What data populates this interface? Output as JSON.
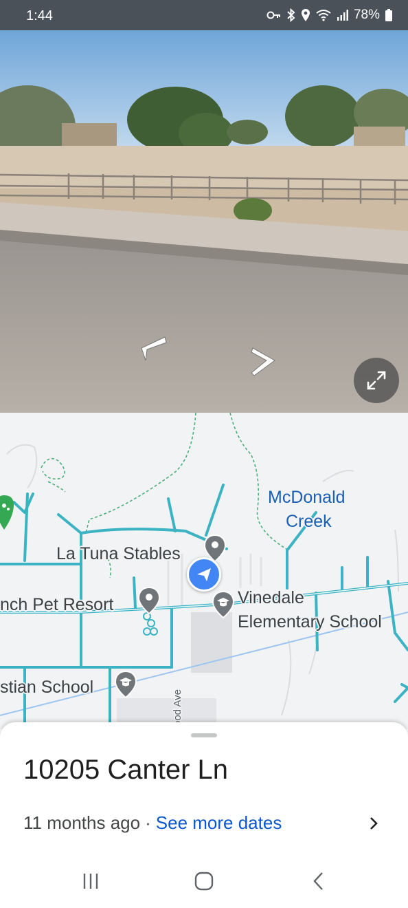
{
  "status_bar": {
    "time": "1:44",
    "battery": "78%",
    "icons": [
      "key-icon",
      "bluetooth-icon",
      "location-icon",
      "wifi-icon",
      "signal-icon",
      "battery-icon"
    ]
  },
  "street_view": {
    "controls": [
      "chevron-left-icon",
      "chevron-right-icon",
      "expand-icon"
    ]
  },
  "map": {
    "labels": {
      "la_tuna_stables": "La Tuna Stables",
      "mcdonald_creek_line1": "McDonald",
      "mcdonald_creek_line2": "Creek",
      "pet_resort": "nch Pet Resort",
      "vinedale_line1": "Vinedale",
      "vinedale_line2": "Elementary School",
      "christian_school": "stian School",
      "street_partial": "ood Ave"
    },
    "colors": {
      "road": "#3bb3c3",
      "water_label": "#1a5fb4",
      "location_dot": "#4285f4",
      "pin": "#70757a"
    }
  },
  "sheet": {
    "address": "10205 Canter Ln",
    "date": "11 months ago",
    "separator": "·",
    "see_more": "See more dates"
  },
  "system_nav": {
    "buttons": [
      "recents-icon",
      "home-icon",
      "back-icon"
    ]
  }
}
